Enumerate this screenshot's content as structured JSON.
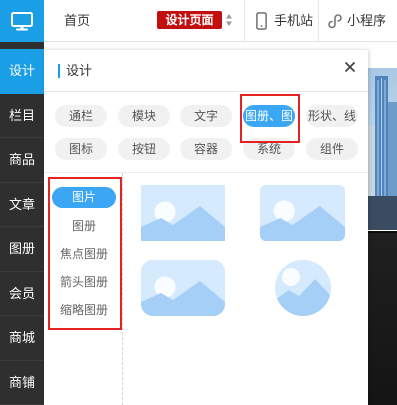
{
  "topbar": {
    "logo_icon": "monitor-icon",
    "home": "首页",
    "page_badge": "设计页面",
    "sort_icon": "sort-arrows-icon",
    "mobile": {
      "icon": "phone-icon",
      "label": "手机站"
    },
    "mini_program": {
      "icon": "mini-program-icon",
      "label": "小程序"
    }
  },
  "sidebar": {
    "items": [
      {
        "label": "设计",
        "active": true
      },
      {
        "label": "栏目",
        "active": false
      },
      {
        "label": "商品",
        "active": false
      },
      {
        "label": "文章",
        "active": false
      },
      {
        "label": "图册",
        "active": false
      },
      {
        "label": "会员",
        "active": false
      },
      {
        "label": "商城",
        "active": false
      },
      {
        "label": "商铺",
        "active": false
      }
    ]
  },
  "panel": {
    "title": "设计",
    "close_icon": "close-icon",
    "categories": [
      {
        "label": "通栏",
        "active": false
      },
      {
        "label": "模块",
        "active": false
      },
      {
        "label": "文字",
        "active": false
      },
      {
        "label": "图册、图",
        "active": true
      },
      {
        "label": "形状、线",
        "active": false
      },
      {
        "label": "图标",
        "active": false
      },
      {
        "label": "按钮",
        "active": false
      },
      {
        "label": "容器",
        "active": false
      },
      {
        "label": "系统",
        "active": false
      },
      {
        "label": "组件",
        "active": false
      }
    ],
    "subcategories": [
      {
        "label": "图片",
        "active": true
      },
      {
        "label": "图册",
        "active": false
      },
      {
        "label": "焦点图册",
        "active": false
      },
      {
        "label": "箭头图册",
        "active": false
      },
      {
        "label": "缩略图册",
        "active": false
      }
    ],
    "image_styles": [
      {
        "icon": "image-square-icon"
      },
      {
        "icon": "image-rounded-icon"
      },
      {
        "icon": "image-round-corner-icon"
      },
      {
        "icon": "image-circle-icon"
      }
    ]
  },
  "colors": {
    "accent": "#1a9fe6",
    "pill_active": "#3aa6f4",
    "badge": "#c20f0f",
    "highlight_box": "#e42222",
    "sidebar": "#2f2f2f",
    "tag": "#f1f1f1"
  }
}
